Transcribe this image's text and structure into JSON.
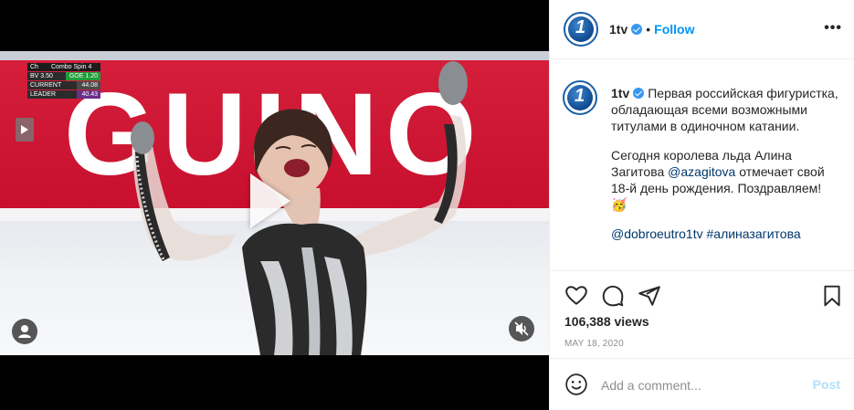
{
  "video": {
    "banner_text": "GUINO",
    "scoreboard": {
      "header_left": "Ch",
      "header_right": "Combo Spin 4",
      "rows": [
        {
          "k": "BV 3.50",
          "v": "GOE 1.20"
        },
        {
          "k": "CURRENT",
          "v": "44.08"
        },
        {
          "k": "LEADER",
          "v": "40.43"
        }
      ]
    }
  },
  "post": {
    "username": "1tv",
    "follow_label": "Follow",
    "dot": "•",
    "more_label": "•••",
    "caption": {
      "username": "1tv",
      "para1": "Первая российская фигуристка, обладающая всеми возможными титулами в одиночном катании.",
      "para2_before": "Сегодня королева льда Алина Загитова ",
      "para2_mention": "@azagitova",
      "para2_after": " отмечает свой 18-й день рождения. Поздравляем!",
      "emoji": "🥳",
      "tags": "@dobroeutro1tv #алиназагитова"
    },
    "views": "106,388 views",
    "date": "MAY 18, 2020",
    "comment_placeholder": "Add a comment...",
    "post_label": "Post"
  },
  "colors": {
    "accent": "#0095f6",
    "banner_red": "#c8102e",
    "avatar_blue": "#1b5fa6"
  }
}
